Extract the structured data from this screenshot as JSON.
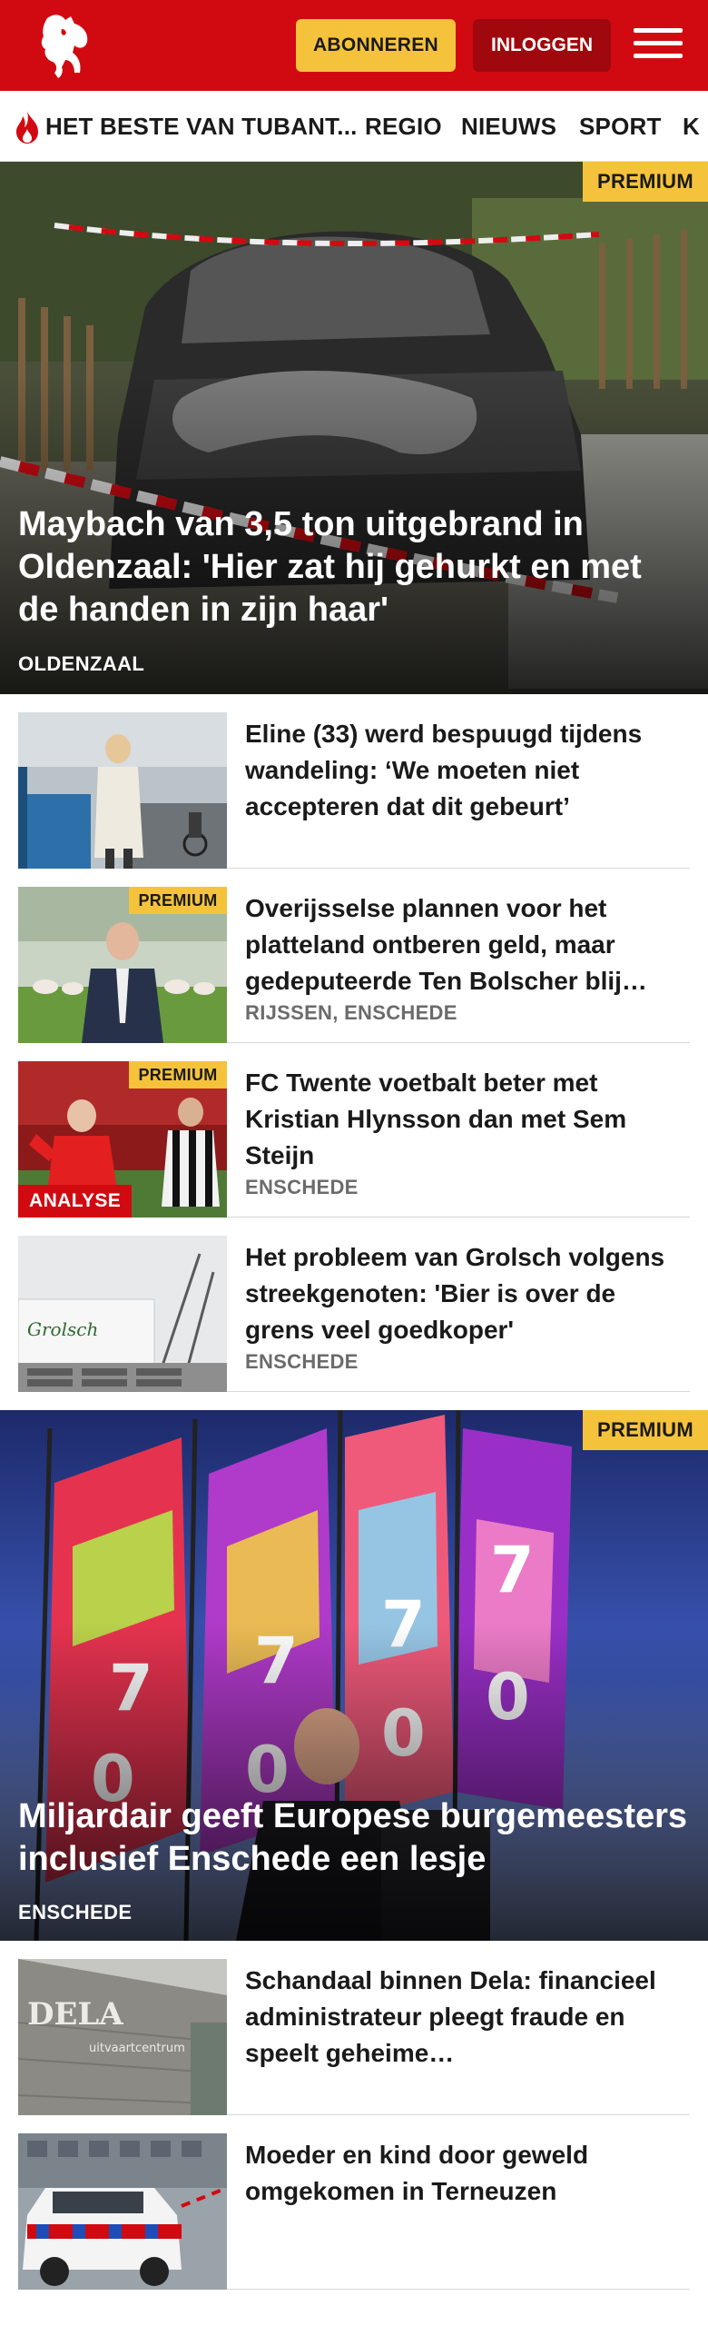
{
  "header": {
    "subscribe_label": "ABONNEREN",
    "login_label": "INLOGGEN",
    "brand_color": "#d10a11"
  },
  "nav": {
    "items": [
      {
        "label": "HET BESTE VAN TUBANT..."
      },
      {
        "label": "REGIO"
      },
      {
        "label": "NIEUWS"
      },
      {
        "label": "SPORT"
      },
      {
        "label": "K"
      }
    ]
  },
  "hero1": {
    "badge": "PREMIUM",
    "title": "Maybach van 3,5 ton uitgebrand in Oldenzaal: 'Hier zat hij gehurkt en met de handen in zijn haar'",
    "tag": "OLDENZAAL"
  },
  "articles": [
    {
      "title": "Eline (33) werd bespuugd tijdens wandeling: ‘We moeten niet accepteren dat dit gebeurt’",
      "tag": ""
    },
    {
      "badge": "PREMIUM",
      "title": "Overijsselse plannen voor het platteland ontberen geld, maar gedeputeerde Ten Bolscher blij…",
      "tag": "RIJSSEN, ENSCHEDE"
    },
    {
      "badge": "PREMIUM",
      "label": "ANALYSE",
      "title": "FC Twente voetbalt beter met Kristian Hlynsson dan met Sem Steijn",
      "tag": "ENSCHEDE"
    },
    {
      "title": "Het probleem van Grolsch volgens streekgenoten: 'Bier is over de grens veel goedkoper'",
      "tag": "ENSCHEDE"
    }
  ],
  "hero2": {
    "badge": "PREMIUM",
    "title": "Miljardair geeft Europese burgemees­ters inclusief Enschede een lesje",
    "tag": "ENSCHEDE"
  },
  "articles2": [
    {
      "title": "Schandaal binnen Dela: financieel administrateur pleegt fraude en speelt geheime…",
      "tag": ""
    },
    {
      "title": "Moeder en kind door geweld omgekomen in Terneuzen",
      "tag": ""
    }
  ]
}
